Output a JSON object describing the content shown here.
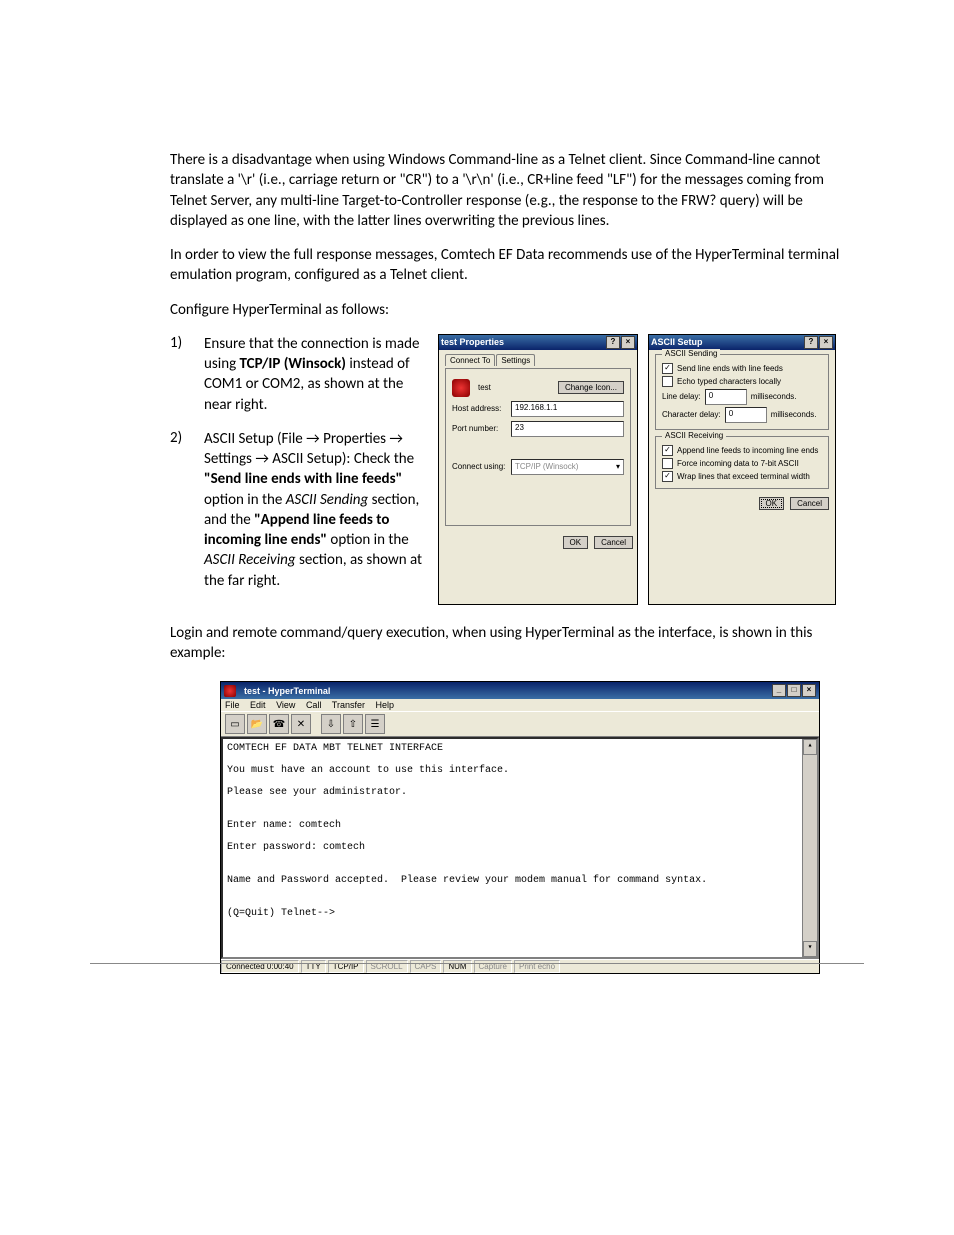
{
  "para1": "There is a disadvantage when using Windows Command-line as a Telnet client. Since Command-line cannot translate a '\\r' (i.e., carriage return or \"CR\") to a '\\r\\n' (i.e., CR+line feed \"LF\") for the messages coming from Telnet Server, any multi-line Target-to-Controller response (e.g., the response to the FRW? query) will be displayed as one line, with the latter lines overwriting the previous lines.",
  "para2": "In order to view the full response messages, Comtech EF Data recommends use of the HyperTerminal terminal emulation program, configured as a Telnet client.",
  "para3": "Configure HyperTerminal as follows:",
  "list": {
    "n1": "1)",
    "i1a": "Ensure that the connection is made using ",
    "i1b": "TCP/IP (Winsock)",
    "i1c": " instead of COM1 or COM2, as shown at the near right.",
    "n2": "2)",
    "i2a": "ASCII Setup (File → Properties → Settings → ASCII Setup): Check the ",
    "i2b": "\"Send line ends with line feeds\"",
    "i2c": " option in the ",
    "i2d": "ASCII Sending",
    "i2e": " section, and the ",
    "i2f": "\"Append line feeds to incoming line ends\"",
    "i2g": " option in the ",
    "i2h": "ASCII Receiving",
    "i2i": " section, as shown at the far right."
  },
  "para4": "Login and remote command/query execution, when using HyperTerminal as the interface, is shown in this example:",
  "dlg1": {
    "title": "test Properties",
    "help": "?",
    "close": "×",
    "tab1": "Connect To",
    "tab2": "Settings",
    "name": "test",
    "changeIcon": "Change Icon...",
    "hostLabel": "Host address:",
    "hostVal": "192.168.1.1",
    "portLabel": "Port number:",
    "portVal": "23",
    "connLabel": "Connect using:",
    "connVal": "TCP/IP (Winsock)",
    "ok": "OK",
    "cancel": "Cancel"
  },
  "dlg2": {
    "title": "ASCII Setup",
    "help": "?",
    "close": "×",
    "g1": "ASCII Sending",
    "c1": "Send line ends with line feeds",
    "c2": "Echo typed characters locally",
    "lineDelayLbl": "Line delay:",
    "lineDelayVal": "0",
    "lineDelayUnit": "milliseconds.",
    "charDelayLbl": "Character delay:",
    "charDelayVal": "0",
    "charDelayUnit": "milliseconds.",
    "g2": "ASCII Receiving",
    "c3": "Append line feeds to incoming line ends",
    "c4": "Force incoming data to 7-bit ASCII",
    "c5": "Wrap lines that exceed terminal width",
    "ok": "OK",
    "cancel": "Cancel"
  },
  "ht": {
    "title": "test - HyperTerminal",
    "min": "_",
    "max": "□",
    "close": "×",
    "menu": {
      "file": "File",
      "edit": "Edit",
      "view": "View",
      "call": "Call",
      "transfer": "Transfer",
      "help": "Help"
    },
    "term": "COMTECH EF DATA MBT TELNET INTERFACE\n\nYou must have an account to use this interface.\n\nPlease see your administrator.\n\n\nEnter name: comtech\n\nEnter password: comtech\n\n\nName and Password accepted.  Please review your modem manual for command syntax.\n\n\n(Q=Quit) Telnet-->",
    "status": {
      "conn": "Connected 0:00:40",
      "tty": "TTY",
      "proto": "TCP/IP",
      "scroll": "SCROLL",
      "caps": "CAPS",
      "num": "NUM",
      "capture": "Capture",
      "echo": "Print echo"
    }
  }
}
